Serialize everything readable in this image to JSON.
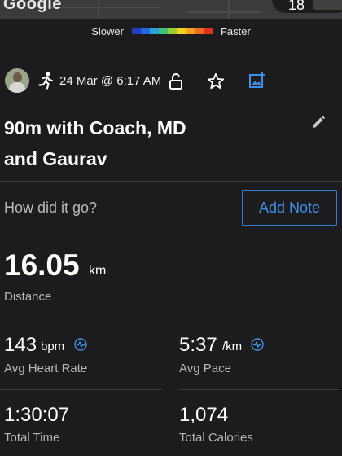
{
  "map": {
    "provider_logo": "Google",
    "lap_badge": "18"
  },
  "legend": {
    "slower": "Slower",
    "faster": "Faster",
    "colors": [
      "#1f3fbf",
      "#2266e0",
      "#2aa0e0",
      "#3cc07a",
      "#9acd32",
      "#f0d020",
      "#f5a020",
      "#f06a20",
      "#e03020"
    ]
  },
  "activity": {
    "type_icon": "running-icon",
    "datetime": "24 Mar @ 6:17 AM",
    "title": "90m with Coach, MD and Gaurav",
    "title_lines": [
      "90m with Coach, MD",
      "and Gaurav"
    ]
  },
  "note": {
    "question": "How did it go?",
    "button_label": "Add Note"
  },
  "stats": {
    "distance": {
      "value": "16.05",
      "unit": "km",
      "label": "Distance"
    },
    "heart_rate": {
      "value": "143",
      "unit": "bpm",
      "label": "Avg Heart Rate"
    },
    "pace": {
      "value": "5:37",
      "unit": "/km",
      "label": "Avg Pace"
    },
    "time": {
      "value": "1:30:07",
      "label": "Total Time"
    },
    "calories": {
      "value": "1,074",
      "label": "Total Calories"
    }
  },
  "colors": {
    "background": "#1c1c1e",
    "accent": "#3d8fe6",
    "muted_text": "#b8b8bc",
    "divider": "#3a3a3c"
  }
}
